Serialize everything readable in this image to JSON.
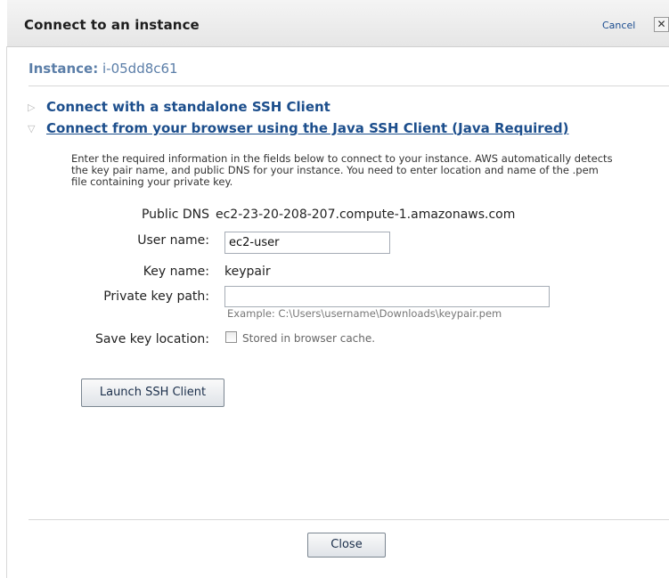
{
  "dialog": {
    "title": "Connect to an instance",
    "cancel_label": "Cancel",
    "close_glyph": "✕"
  },
  "instance": {
    "label": "Instance:",
    "id": "i-05dd8c61"
  },
  "sections": {
    "standalone": {
      "label": "Connect with a standalone SSH Client",
      "expanded": false,
      "icon": "triangle-right-icon"
    },
    "browser": {
      "label": "Connect from your browser using the Java SSH Client (Java Required)",
      "expanded": true,
      "icon": "triangle-down-icon"
    }
  },
  "intro_text": "Enter the required information in the fields below to connect to your instance. AWS automatically detects the key pair name, and public DNS for your instance. You need to enter location and name of the .pem file containing your private key.",
  "form": {
    "public_dns_label": "Public DNS",
    "public_dns_value": "ec2-23-20-208-207.compute-1.amazonaws.com",
    "user_name_label": "User name:",
    "user_name_value": "ec2-user",
    "key_name_label": "Key name:",
    "key_name_value": "keypair",
    "private_key_label": "Private key path:",
    "private_key_value": "",
    "private_key_example": "Example: C:\\Users\\username\\Downloads\\keypair.pem",
    "save_key_label": "Save key location:",
    "save_key_checked": false,
    "save_key_checkbox_label": "Stored in browser cache."
  },
  "buttons": {
    "launch": "Launch SSH Client",
    "close": "Close"
  },
  "colors": {
    "link_blue": "#1c4e8c",
    "instance_blue": "#5b7ea8"
  }
}
